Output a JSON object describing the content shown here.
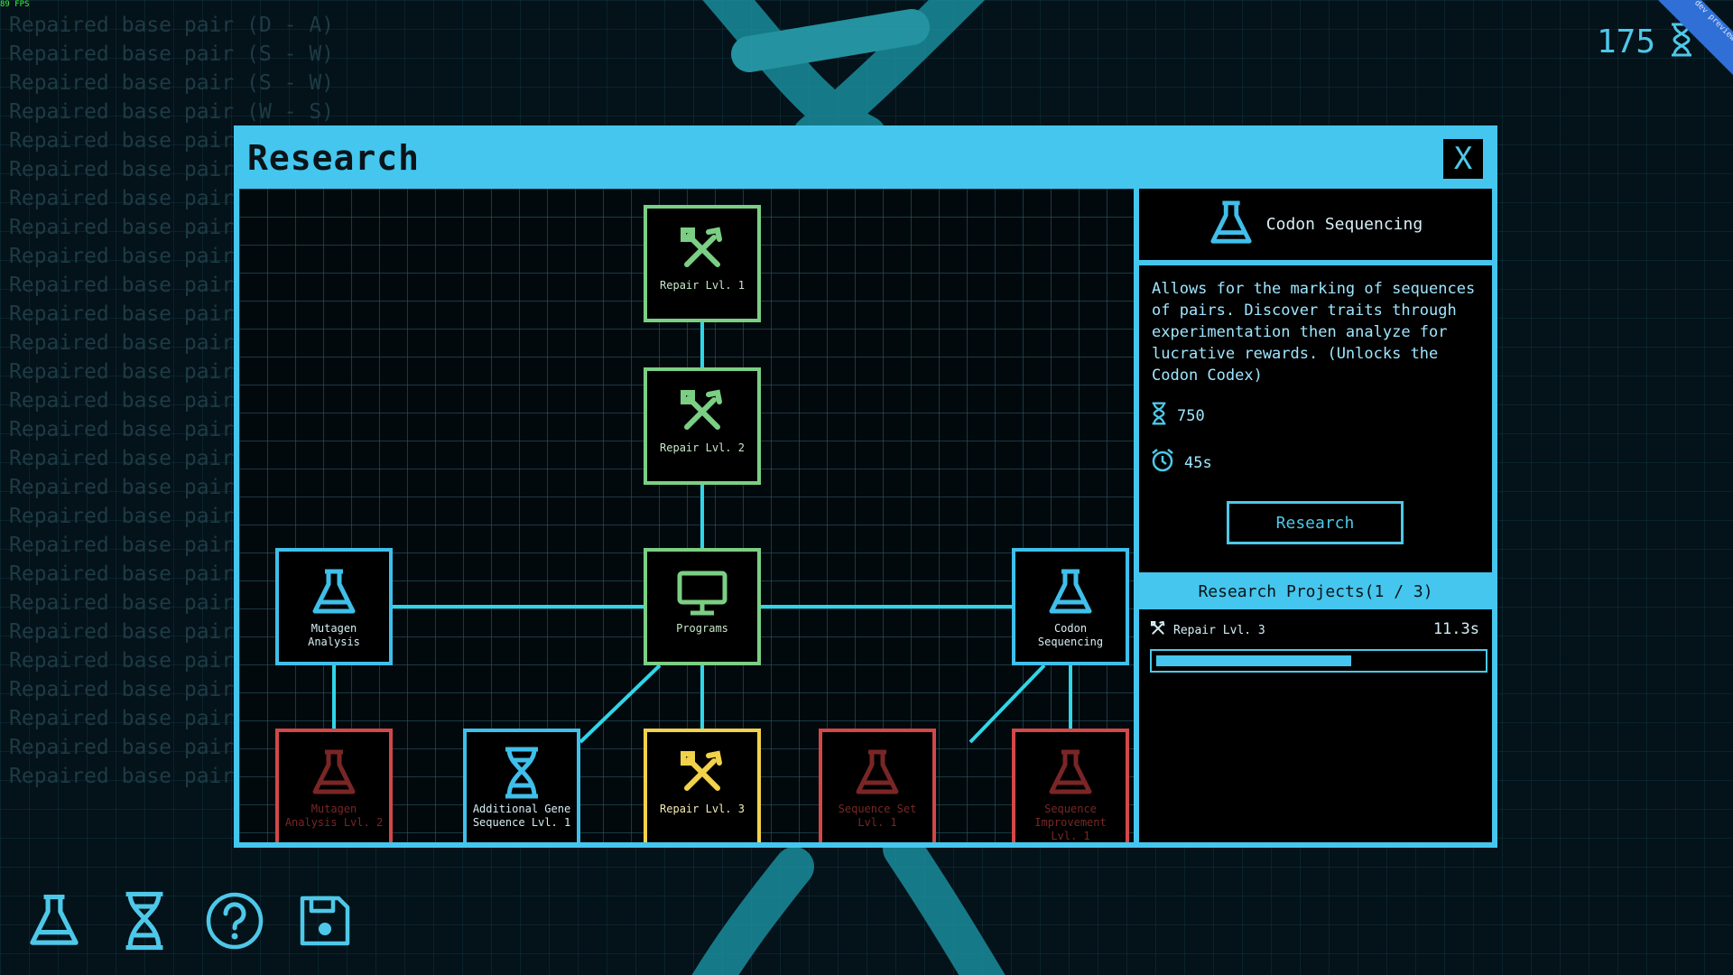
{
  "hud": {
    "fps": "89 FPS",
    "currency_value": "175",
    "corner_ribbon": "dev preview"
  },
  "log": [
    "Repaired base pair (D - A)",
    "Repaired base pair (S - W)",
    "Repaired base pair (S - W)",
    "Repaired base pair (W - S)",
    "Repaired base pair",
    "Repaired base pair",
    "Repaired base pair",
    "Repaired base pair",
    "Repaired base pair",
    "Repaired base pair",
    "Repaired base pair",
    "Repaired base pair",
    "Repaired base pair",
    "Repaired base pair",
    "Repaired base pair",
    "Repaired base pair",
    "Repaired base pair",
    "Repaired base pair",
    "Repaired base pair",
    "Repaired base pair",
    "Repaired base pair",
    "Repaired base pair",
    "Repaired base pair",
    "Repaired base pair",
    "Repaired base pair",
    "Repaired base pair",
    "Repaired base pair"
  ],
  "research": {
    "title": "Research",
    "close_label": "X",
    "nodes": {
      "repair1": {
        "label": "Repair Lvl. 1",
        "state": "done",
        "icon": "tools-icon"
      },
      "repair2": {
        "label": "Repair Lvl. 2",
        "state": "done",
        "icon": "tools-icon"
      },
      "programs": {
        "label": "Programs",
        "state": "done",
        "icon": "monitor-icon"
      },
      "mutagen": {
        "label": "Mutagen Analysis",
        "state": "available",
        "icon": "flask-icon"
      },
      "codon": {
        "label": "Codon Sequencing",
        "state": "available",
        "icon": "flask-icon"
      },
      "mutagen2": {
        "label": "Mutagen Analysis Lvl. 2",
        "state": "locked",
        "icon": "flask-icon"
      },
      "addgene": {
        "label": "Additional Gene Sequence Lvl. 1",
        "state": "available",
        "icon": "dna-icon"
      },
      "repair3": {
        "label": "Repair Lvl. 3",
        "state": "in-progress",
        "icon": "tools-icon"
      },
      "seqset": {
        "label": "Sequence Set Lvl. 1",
        "state": "locked",
        "icon": "flask-icon"
      },
      "seqimp": {
        "label": "Sequence Improvement Lvl. 1",
        "state": "locked",
        "icon": "flask-icon"
      }
    },
    "detail": {
      "title": "Codon Sequencing",
      "description": "Allows for the marking of sequences of pairs. Discover traits through experimentation then analyze for lucrative rewards. (Unlocks the Codon Codex)",
      "cost": "750",
      "time": "45s",
      "button_label": "Research"
    },
    "projects": {
      "header": "Research Projects(1 / 3)",
      "items": [
        {
          "name": "Repair Lvl. 3",
          "time": "11.3s",
          "progress": 0.6
        }
      ]
    }
  },
  "colors": {
    "accent": "#45c6ee",
    "done": "#7bcf84",
    "available": "#3fbfea",
    "locked": "#d24848",
    "in_progress": "#f2d24a"
  },
  "dock": [
    "flask-icon",
    "dna-icon",
    "help-icon",
    "save-icon"
  ]
}
